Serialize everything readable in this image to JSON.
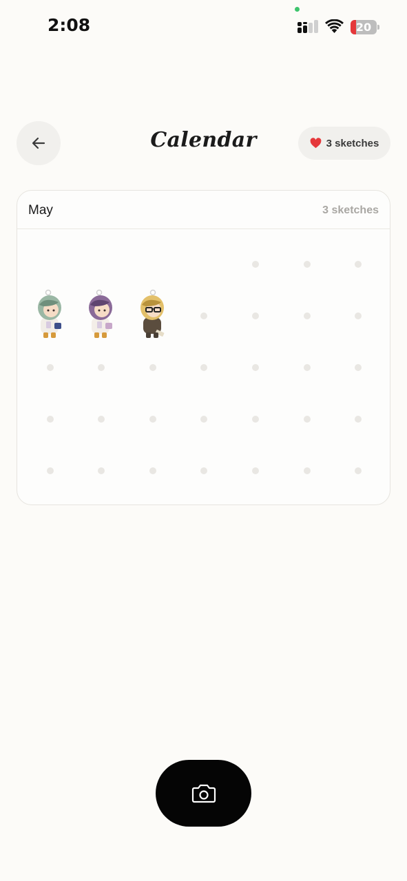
{
  "status_bar": {
    "time": "2:08",
    "battery_level": "20"
  },
  "header": {
    "title": "Calendar",
    "sketch_count_label": "3 sketches"
  },
  "calendar": {
    "month": "May",
    "month_count_label": "3 sketches",
    "days": [
      {
        "sketch": null
      },
      {
        "sketch": null
      },
      {
        "sketch": null
      },
      {
        "sketch": null
      },
      {
        "sketch": null
      },
      {
        "sketch": null
      },
      {
        "sketch": null
      },
      {
        "sketch": "green-hair-doll"
      },
      {
        "sketch": "purple-hair-doll"
      },
      {
        "sketch": "blonde-glasses-doll"
      },
      {
        "sketch": null
      },
      {
        "sketch": null
      },
      {
        "sketch": null
      },
      {
        "sketch": null
      },
      {
        "sketch": null
      },
      {
        "sketch": null
      },
      {
        "sketch": null
      },
      {
        "sketch": null
      },
      {
        "sketch": null
      },
      {
        "sketch": null
      },
      {
        "sketch": null
      },
      {
        "sketch": null
      },
      {
        "sketch": null
      },
      {
        "sketch": null
      },
      {
        "sketch": null
      },
      {
        "sketch": null
      },
      {
        "sketch": null
      },
      {
        "sketch": null
      },
      {
        "sketch": null
      },
      {
        "sketch": null
      },
      {
        "sketch": null
      },
      {
        "sketch": null
      },
      {
        "sketch": null
      },
      {
        "sketch": null
      },
      {
        "sketch": null
      }
    ],
    "first_week_hidden_days": 4
  },
  "colors": {
    "background": "#fcfbf8",
    "heart": "#e5383b",
    "dot": "#e9e7e3",
    "camera_button": "#050505"
  }
}
